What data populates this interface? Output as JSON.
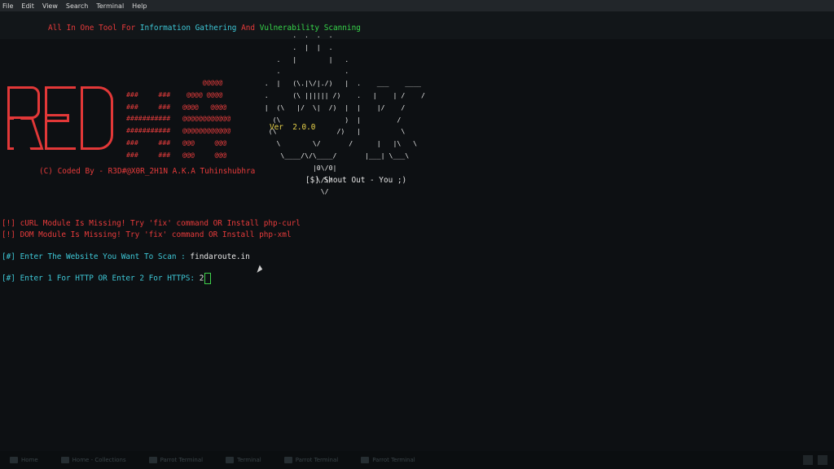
{
  "menu": [
    "File",
    "Edit",
    "View",
    "Search",
    "Terminal",
    "Help"
  ],
  "banner": {
    "part1": "All In One Tool For",
    "part2": "Information Gathering",
    "part3": "And",
    "part4": "Vulnerability Scanning"
  },
  "logo_text": "RED",
  "version_label": "Ver",
  "version": "2.0.0",
  "credit": "(C) Coded By - R3D#@X0R_2H1N A.K.A Tuhinshubhra",
  "shoutout": "[$] Shout Out - You ;)",
  "messages": {
    "curl_missing": "[!] cURL Module Is Missing! Try 'fix' command OR Install php-curl",
    "dom_missing": "[!] DOM Module Is Missing! Try 'fix' command OR Install php-xml",
    "website_prompt": "[#] Enter The Website You Want To Scan : ",
    "website_value": "findaroute.in",
    "protocol_prompt": "[#] Enter 1 For HTTP OR Enter 2 For HTTPS: ",
    "protocol_value": "2"
  },
  "taskbar": [
    "Home",
    "Home - Collections",
    "Parrot Terminal",
    "Terminal",
    "Parrot Terminal",
    "Parrot Terminal"
  ],
  "colors": {
    "accent_red": "#e23c3c",
    "cyan": "#3ec7d6",
    "green": "#37d74a",
    "yellow": "#e8d24a"
  }
}
